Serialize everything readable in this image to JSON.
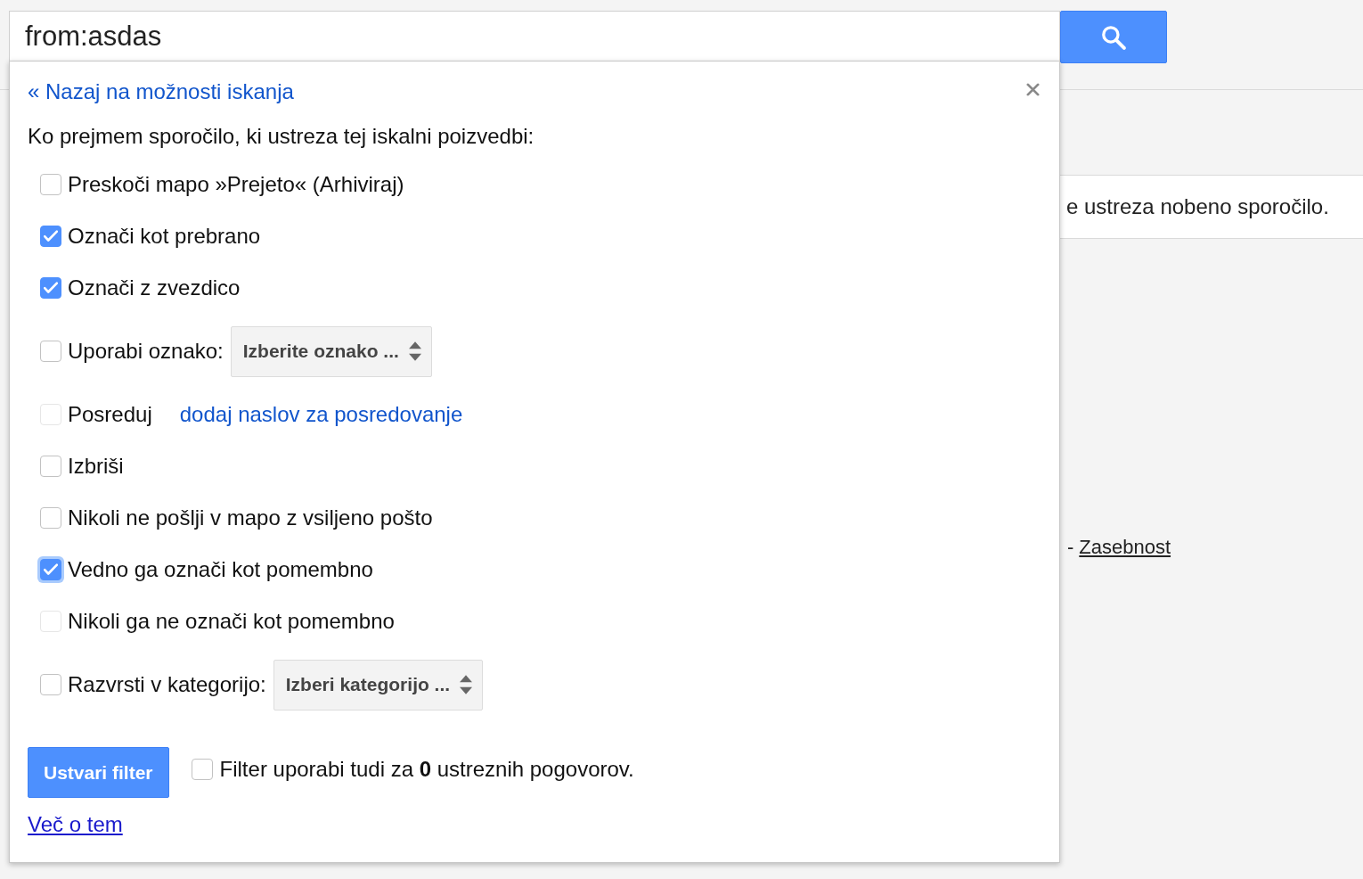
{
  "search": {
    "value": "from:asdas"
  },
  "filter_panel": {
    "back_link": "« Nazaj na možnosti iskanja",
    "heading": "Ko prejmem sporočilo, ki ustreza tej iskalni poizvedbi:",
    "actions": [
      {
        "kind": "plain",
        "label": "Preskoči mapo »Prejeto« (Arhiviraj)",
        "checked": false,
        "disabled": false,
        "focused": false
      },
      {
        "kind": "plain",
        "label": "Označi kot prebrano",
        "checked": true,
        "disabled": false,
        "focused": false
      },
      {
        "kind": "plain",
        "label": "Označi z zvezdico",
        "checked": true,
        "disabled": false,
        "focused": false
      },
      {
        "kind": "select",
        "label": "Uporabi oznako:",
        "checked": false,
        "disabled": false,
        "focused": false,
        "select": "Izberite oznako ..."
      },
      {
        "kind": "link",
        "label": "Posreduj",
        "checked": false,
        "disabled": true,
        "focused": false,
        "link": "dodaj naslov za posredovanje"
      },
      {
        "kind": "plain",
        "label": "Izbriši",
        "checked": false,
        "disabled": false,
        "focused": false
      },
      {
        "kind": "plain",
        "label": "Nikoli ne pošlji v mapo z vsiljeno pošto",
        "checked": false,
        "disabled": false,
        "focused": false
      },
      {
        "kind": "plain",
        "label": "Vedno ga označi kot pomembno",
        "checked": true,
        "disabled": false,
        "focused": true
      },
      {
        "kind": "plain",
        "label": "Nikoli ga ne označi kot pomembno",
        "checked": false,
        "disabled": true,
        "focused": false
      },
      {
        "kind": "select",
        "label": "Razvrsti v kategorijo:",
        "checked": false,
        "disabled": false,
        "focused": false,
        "select": "Izberi kategorijo ..."
      }
    ],
    "create_button": "Ustvari filter",
    "apply_existing": {
      "label": "Filter uporabi tudi za **0** ustreznih pogovorov.",
      "checked": false
    },
    "learn_more": "Več o tem"
  },
  "background": {
    "results_message": "e ustreza nobeno sporočilo.",
    "footer_separator": "-",
    "footer_link": "Zasebnost"
  }
}
